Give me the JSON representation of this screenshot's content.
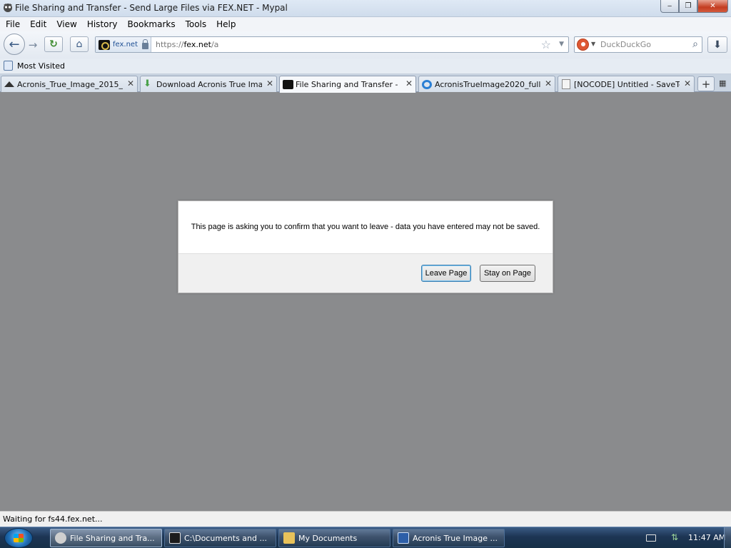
{
  "window": {
    "title": "File Sharing and Transfer - Send Large Files via FEX.NET - Mypal",
    "minimize_label": "‒",
    "maximize_label": "❐",
    "close_label": "✕"
  },
  "menu": [
    "File",
    "Edit",
    "View",
    "History",
    "Bookmarks",
    "Tools",
    "Help"
  ],
  "nav": {
    "back_icon": "arrow-left-icon",
    "identity_label": "fex.net",
    "url_scheme": "https://",
    "url_host": "fex.net",
    "url_path": "/a",
    "search_placeholder": "DuckDuckGo"
  },
  "bookmarks": {
    "most_visited": "Most Visited"
  },
  "tabs": [
    {
      "label": "Acronis_True_Image_2015_v...",
      "icon_color": "#333333",
      "active": false
    },
    {
      "label": "Download Acronis True Ima...",
      "icon_color": "#4aa14a",
      "active": false
    },
    {
      "label": "File Sharing and Transfer - ...",
      "icon_color": "#111111",
      "active": true
    },
    {
      "label": "AcronisTrueImage2020_full_...",
      "icon_color": "#2a7fd4",
      "active": false
    },
    {
      "label": "[NOCODE] Untitled - SaveTe...",
      "icon_color": "#8a8a8a",
      "active": false
    }
  ],
  "dialog": {
    "message": "This page is asking you to confirm that you want to leave - data you have entered may not be saved.",
    "leave_label": "Leave Page",
    "stay_label": "Stay on Page"
  },
  "status": {
    "text": "Waiting for fs44.fex.net..."
  },
  "taskbar": {
    "tasks": [
      {
        "label": "File Sharing and Tra...",
        "icon_color": "#cfcfcf"
      },
      {
        "label": "C:\\Documents and ...",
        "icon_color": "#1c1c1c"
      },
      {
        "label": "My Documents",
        "icon_color": "#e8c25a"
      },
      {
        "label": "Acronis True Image ...",
        "icon_color": "#2d5fa8"
      }
    ],
    "clock": "11:47 AM"
  },
  "colors": {
    "content_bg": "#8a8b8d",
    "accent": "#3c7fb1"
  }
}
